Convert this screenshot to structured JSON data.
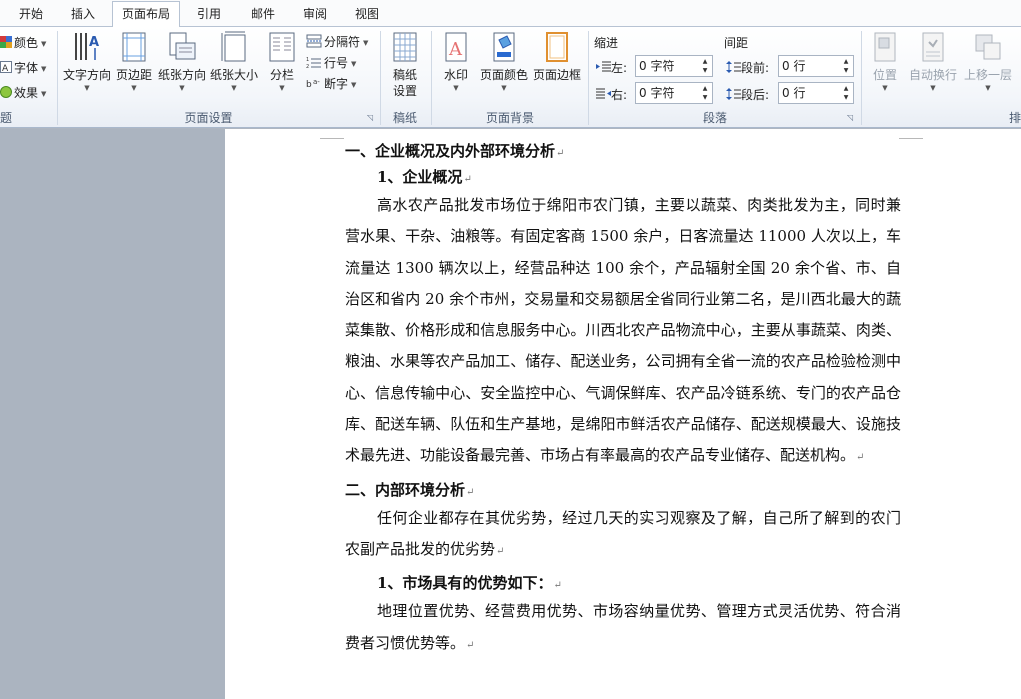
{
  "tabs": [
    {
      "label": "开始",
      "active": false
    },
    {
      "label": "插入",
      "active": false
    },
    {
      "label": "页面布局",
      "active": true
    },
    {
      "label": "引用",
      "active": false
    },
    {
      "label": "邮件",
      "active": false
    },
    {
      "label": "审阅",
      "active": false
    },
    {
      "label": "视图",
      "active": false
    }
  ],
  "ribbon": {
    "theme": {
      "colors_label": "颜色",
      "fonts_label": "字体",
      "effects_label": "效果",
      "group_label": "题"
    },
    "page_setup": {
      "text_direction": "文字方向",
      "margins": "页边距",
      "orientation": "纸张方向",
      "size": "纸张大小",
      "columns": "分栏",
      "breaks": "分隔符",
      "line_numbers": "行号",
      "hyphenation": "断字",
      "group_label": "页面设置"
    },
    "draft_paper": {
      "label_line1": "稿纸",
      "label_line2": "设置",
      "group_label": "稿纸"
    },
    "page_background": {
      "watermark": "水印",
      "page_color": "页面颜色",
      "page_borders": "页面边框",
      "group_label": "页面背景"
    },
    "paragraph": {
      "indent_label": "缩进",
      "spacing_label": "间距",
      "left_label": "左:",
      "right_label": "右:",
      "before_label": "段前:",
      "after_label": "段后:",
      "left_value": "0 字符",
      "right_value": "0 字符",
      "before_value": "0 行",
      "after_value": "0 行",
      "group_label": "段落"
    },
    "arrange": {
      "position": "位置",
      "wrap_text": "自动换行",
      "bring_forward": "上移一层",
      "group_label": "排"
    }
  },
  "document": {
    "h1": "一、企业概况及内外部环境分析",
    "h1_1": "1、企业概况",
    "p1": "高水农产品批发市场位于绵阳市农门镇，主要以蔬菜、肉类批发为主，同时兼营水果、干杂、油粮等。有固定客商 1500 余户，日客流量达 11000 人次以上，车流量达 1300 辆次以上，经营品种达 100 余个，产品辐射全国 20 余个省、市、自治区和省内 20 余个市州，交易量和交易额居全省同行业第二名，是川西北最大的蔬菜集散、价格形成和信息服务中心。川西北农产品物流中心，主要从事蔬菜、肉类、粮油、水果等农产品加工、储存、配送业务，公司拥有全省一流的农产品检验检测中心、信息传输中心、安全监控中心、气调保鲜库、农产品冷链系统、专门的农产品仓库、配送车辆、队伍和生产基地，是绵阳市鲜活农产品储存、配送规模最大、设施技术最先进、功能设备最完善、市场占有率最高的农产品专业储存、配送机构。",
    "h2": "二、内部环境分析",
    "p2": "任何企业都存在其优劣势，经过几天的实习观察及了解，自己所了解到的农门农副产品批发的优劣势",
    "h2_1": "1、市场具有的优势如下：",
    "p3": "地理位置优势、经营费用优势、市场容纳量优势、管理方式灵活优势、符合消费者习惯优势等。",
    "para_mark": "↵"
  }
}
